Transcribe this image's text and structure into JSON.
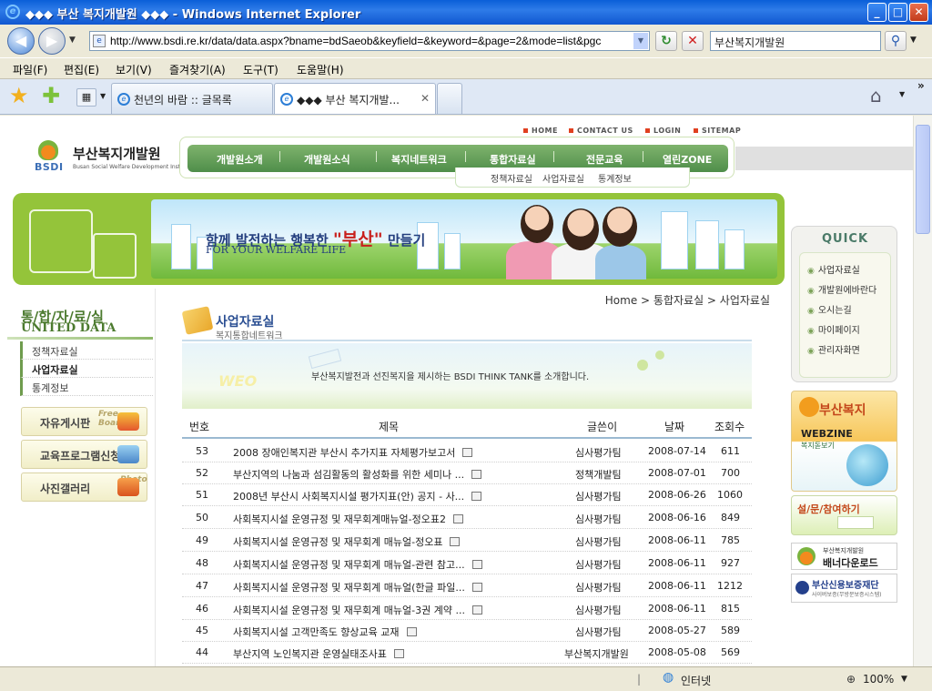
{
  "window": {
    "title": "◆◆◆ 부산 복지개발원 ◆◆◆ - Windows Internet Explorer"
  },
  "address": {
    "url": "http://www.bsdi.re.kr/data/data.aspx?bname=bdSaeob&keyfield=&keyword=&page=2&mode=list&pgc",
    "search_value": "부산복지개발원"
  },
  "menu": [
    "파일(F)",
    "편집(E)",
    "보기(V)",
    "즐겨찾기(A)",
    "도구(T)",
    "도움말(H)"
  ],
  "tabs": [
    {
      "label": "천년의 바람 :: 글목록"
    },
    {
      "label": "◆◆◆ 부산 복지개발..."
    }
  ],
  "toplinks": [
    "HOME",
    "CONTACT US",
    "LOGIN",
    "SITEMAP"
  ],
  "logo": {
    "brand": "BSDI",
    "name": "부산복지개발원",
    "english": "Busan Social Welfare Development Institute"
  },
  "gnb": [
    "개발원소개",
    "개발원소식",
    "복지네트워크",
    "통합자료실",
    "전문교육",
    "열린ZONE"
  ],
  "subnav": [
    "정책자료실",
    "사업자료실",
    "통계정보"
  ],
  "banner": {
    "slogan_a": "함께 발전하는 행복한 ",
    "slogan_b": "\"부산\"",
    "slogan_c": " 만들기",
    "english": "FOR YOUR WELFARE LIFE"
  },
  "left": {
    "title": "통/합/자/료/실",
    "subtitle": "UNITED DATA",
    "items": [
      "정책자료실",
      "사업자료실",
      "통계정보"
    ],
    "buttons": [
      "자유게시판",
      "교육프로그램신청",
      "사진갤러리"
    ],
    "button_deco": [
      "Free Board",
      "",
      "Photo"
    ]
  },
  "breadcrumb": "Home > 통합자료실 > 사업자료실",
  "content": {
    "title": "사업자료실",
    "subtitle": "복지통합네트워크",
    "intro": "부산복지발전과 선진복지을 제시하는 BSDI THINK TANK를 소개합니다.",
    "intro_deco": "WEO"
  },
  "table": {
    "headers": [
      "번호",
      "제목",
      "글쓴이",
      "날짜",
      "조회수"
    ],
    "rows": [
      {
        "no": "53",
        "subject": "2008 장애인복지관 부산시 추가지표 자체평가보고서",
        "writer": "심사평가팀",
        "date": "2008-07-14",
        "views": "611"
      },
      {
        "no": "52",
        "subject": "부산지역의 나눔과 섬김활동의 활성화를 위한 세미나 ...",
        "writer": "정책개발팀",
        "date": "2008-07-01",
        "views": "700"
      },
      {
        "no": "51",
        "subject": "2008년 부산시 사회복지시설 평가지표(안) 공지 - 사...",
        "writer": "심사평가팀",
        "date": "2008-06-26",
        "views": "1060"
      },
      {
        "no": "50",
        "subject": "사회복지시설 운영규정 및 재무회계매뉴얼-정오표2",
        "writer": "심사평가팀",
        "date": "2008-06-16",
        "views": "849"
      },
      {
        "no": "49",
        "subject": "사회복지시설 운영규정 및 재무회계 매뉴얼-정오표",
        "writer": "심사평가팀",
        "date": "2008-06-11",
        "views": "785"
      },
      {
        "no": "48",
        "subject": "사회복지시설 운영규정 및 재무회계 매뉴얼-관련 참고...",
        "writer": "심사평가팀",
        "date": "2008-06-11",
        "views": "927"
      },
      {
        "no": "47",
        "subject": "사회복지시설 운영규정 및 재무회계 매뉴얼(한글 파일...",
        "writer": "심사평가팀",
        "date": "2008-06-11",
        "views": "1212"
      },
      {
        "no": "46",
        "subject": "사회복지시설 운영규정 및 재무회계 매뉴얼-3권 계약 ...",
        "writer": "심사평가팀",
        "date": "2008-06-11",
        "views": "815"
      },
      {
        "no": "45",
        "subject": "사회복지시설 고객만족도 향상교육 교재",
        "writer": "심사평가팀",
        "date": "2008-05-27",
        "views": "589"
      },
      {
        "no": "44",
        "subject": "부산지역 노인복지관 운영실태조사표",
        "writer": "부산복지개발원",
        "date": "2008-05-08",
        "views": "569"
      }
    ]
  },
  "quick": {
    "title": "QUICK",
    "items": [
      "사업자료실",
      "개발원에바란다",
      "오시는길",
      "마이페이지",
      "관리자화면"
    ]
  },
  "webzine": {
    "a": "부산복지",
    "b": "WEBZINE",
    "c": "복지돋보기"
  },
  "survey": "설/문/참여하기",
  "banner_dl": {
    "org": "부산복지개발원",
    "label": "배너다운로드"
  },
  "credit": {
    "name": "부산신용보증재단",
    "sub": "사이버보증(무방문보증시스템)"
  },
  "status": {
    "zone": "인터넷",
    "zoom": "100%"
  }
}
